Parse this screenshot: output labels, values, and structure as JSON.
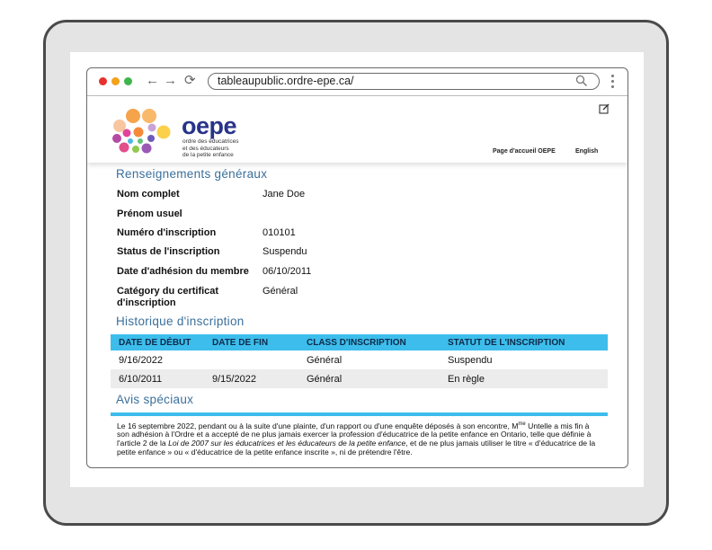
{
  "browser": {
    "url": "tableaupublic.ordre-epe.ca/",
    "nav": {
      "back": "←",
      "forward": "→",
      "reload": "⟳"
    }
  },
  "header": {
    "logo_word": "oepe",
    "logo_lines": [
      "ordre des éducatrices",
      "et des éducateurs",
      "de la petite enfance"
    ],
    "home_link": "Page d'accueil OEPE",
    "language_link": "English"
  },
  "general": {
    "title": "Renseignements généraux",
    "fields": [
      {
        "label": "Nom complet",
        "value": "Jane Doe"
      },
      {
        "label": "Prénom usuel",
        "value": ""
      },
      {
        "label": "Numéro d'inscription",
        "value": "010101"
      },
      {
        "label": "Status de l'inscription",
        "value": "Suspendu"
      },
      {
        "label": "Date d'adhésion du membre",
        "value": "06/10/2011"
      },
      {
        "label": "Catégory du certificat",
        "label2": "d'inscription",
        "value": "Général"
      }
    ]
  },
  "history": {
    "title": "Historique d'inscription",
    "columns": [
      "DATE DE DÉBUT",
      "DATE DE FIN",
      "CLASS D'INSCRIPTION",
      "STATUT DE L'INSCRIPTION"
    ],
    "rows": [
      [
        "9/16/2022",
        "",
        "Général",
        "Suspendu"
      ],
      [
        "6/10/2011",
        "9/15/2022",
        "Général",
        "En règle"
      ]
    ]
  },
  "notices": {
    "title": "Avis spéciaux",
    "text_a": "Le 16 septembre 2022, pendant ou à la suite d'une plainte, d'un rapport ou d'une enquête déposés à son encontre, M",
    "superscript": "me",
    "text_b": " Untelle a mis fin à son adhésion à l'Ordre et a accepté de ne plus jamais exercer la profession d'éducatrice de la petite enfance en Ontario, telle que définie à l'article 2 de la ",
    "italic": "Loi de 2007 sur les éducatrices et les éducateurs de la petite enfance",
    "text_c": ", et de ne plus jamais utiliser le titre « d'éducatrice de la petite enfance » ou « d'éducatrice de la petite enfance inscrite », ni de prétendre l'être."
  },
  "colors": {
    "accent": "#3dbdeb",
    "section_title": "#3a6f9b",
    "logo": "#28338a",
    "traffic_lights": [
      "#e8302f",
      "#f4a11b",
      "#3fb54a"
    ]
  },
  "icons": [
    "search-icon",
    "more-vert-icon",
    "edit-icon",
    "back-arrow-icon",
    "forward-arrow-icon",
    "reload-icon"
  ]
}
